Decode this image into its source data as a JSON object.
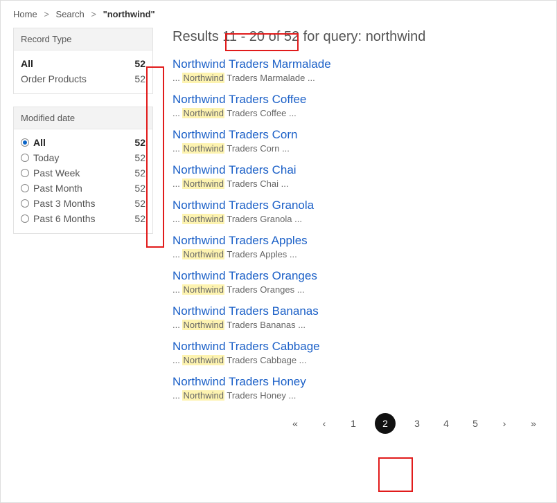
{
  "breadcrumb": {
    "home": "Home",
    "search": "Search",
    "current": "\"northwind\""
  },
  "results_header": {
    "prefix": "Results ",
    "range": "11 - 20 of 52",
    "suffix": " for query: ",
    "query": "northwind"
  },
  "facets": {
    "recordType": {
      "title": "Record Type",
      "rows": [
        {
          "label": "All",
          "count": "52",
          "selected": true
        },
        {
          "label": "Order Products",
          "count": "52",
          "selected": false
        }
      ]
    },
    "modifiedDate": {
      "title": "Modified date",
      "rows": [
        {
          "label": "All",
          "count": "52",
          "checked": true
        },
        {
          "label": "Today",
          "count": "52",
          "checked": false
        },
        {
          "label": "Past Week",
          "count": "52",
          "checked": false
        },
        {
          "label": "Past Month",
          "count": "52",
          "checked": false
        },
        {
          "label": "Past 3 Months",
          "count": "52",
          "checked": false
        },
        {
          "label": "Past 6 Months",
          "count": "52",
          "checked": false
        }
      ]
    }
  },
  "highlight_word": "Northwind",
  "results": [
    {
      "title": "Northwind Traders Marmalade",
      "snippet_prefix": "... ",
      "snippet_rest": " Traders Marmalade ..."
    },
    {
      "title": "Northwind Traders Coffee",
      "snippet_prefix": "... ",
      "snippet_rest": " Traders Coffee ..."
    },
    {
      "title": "Northwind Traders Corn",
      "snippet_prefix": "... ",
      "snippet_rest": " Traders Corn ..."
    },
    {
      "title": "Northwind Traders Chai",
      "snippet_prefix": "... ",
      "snippet_rest": " Traders Chai ..."
    },
    {
      "title": "Northwind Traders Granola",
      "snippet_prefix": "... ",
      "snippet_rest": " Traders Granola ..."
    },
    {
      "title": "Northwind Traders Apples",
      "snippet_prefix": "... ",
      "snippet_rest": " Traders Apples ..."
    },
    {
      "title": "Northwind Traders Oranges",
      "snippet_prefix": "... ",
      "snippet_rest": " Traders Oranges ..."
    },
    {
      "title": "Northwind Traders Bananas",
      "snippet_prefix": "... ",
      "snippet_rest": " Traders Bananas ..."
    },
    {
      "title": "Northwind Traders Cabbage",
      "snippet_prefix": "... ",
      "snippet_rest": " Traders Cabbage ..."
    },
    {
      "title": "Northwind Traders Honey",
      "snippet_prefix": "... ",
      "snippet_rest": " Traders Honey ..."
    }
  ],
  "pagination": {
    "first": "«",
    "prev": "‹",
    "pages": [
      "1",
      "2",
      "3",
      "4",
      "5"
    ],
    "current": "2",
    "next": "›",
    "last": "»"
  }
}
